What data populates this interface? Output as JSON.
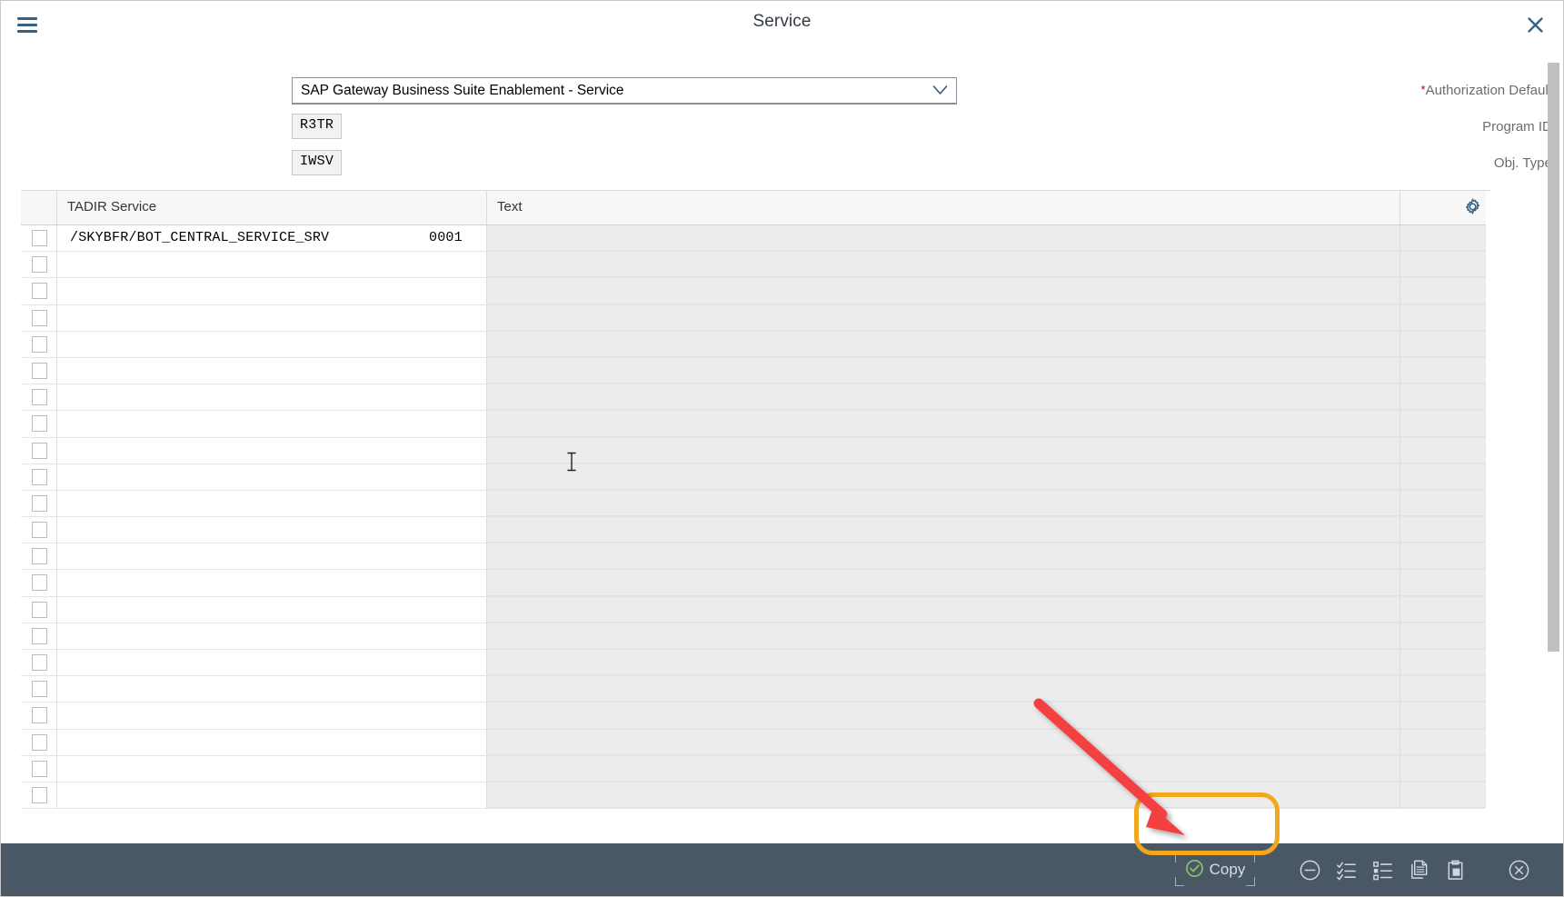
{
  "window": {
    "title": "Service",
    "menu_icon": "hamburger-menu-icon",
    "close_icon": "close-icon"
  },
  "form": {
    "authorization_default": {
      "label": "Authorization Default:",
      "required": true,
      "value": "SAP Gateway Business Suite Enablement - Service",
      "dropdown_icon": "chevron-down-icon"
    },
    "program_id": {
      "label": "Program ID:",
      "value": "R3TR",
      "readonly": true
    },
    "obj_type": {
      "label": "Obj. Type:",
      "value": "IWSV",
      "readonly": true
    }
  },
  "table": {
    "columns": [
      {
        "key": "select",
        "label": ""
      },
      {
        "key": "service",
        "label": "TADIR Service"
      },
      {
        "key": "text",
        "label": "Text"
      },
      {
        "key": "extra",
        "label": ""
      }
    ],
    "settings_icon": "gear-icon",
    "rows": [
      {
        "selected": false,
        "service": "/SKYBFR/BOT_CENTRAL_SERVICE_SRV",
        "version": "0001",
        "text": ""
      },
      {
        "selected": false,
        "service": "",
        "version": "",
        "text": ""
      },
      {
        "selected": false,
        "service": "",
        "version": "",
        "text": ""
      },
      {
        "selected": false,
        "service": "",
        "version": "",
        "text": ""
      },
      {
        "selected": false,
        "service": "",
        "version": "",
        "text": ""
      },
      {
        "selected": false,
        "service": "",
        "version": "",
        "text": ""
      },
      {
        "selected": false,
        "service": "",
        "version": "",
        "text": ""
      },
      {
        "selected": false,
        "service": "",
        "version": "",
        "text": ""
      },
      {
        "selected": false,
        "service": "",
        "version": "",
        "text": ""
      },
      {
        "selected": false,
        "service": "",
        "version": "",
        "text": ""
      },
      {
        "selected": false,
        "service": "",
        "version": "",
        "text": ""
      },
      {
        "selected": false,
        "service": "",
        "version": "",
        "text": ""
      },
      {
        "selected": false,
        "service": "",
        "version": "",
        "text": ""
      },
      {
        "selected": false,
        "service": "",
        "version": "",
        "text": ""
      },
      {
        "selected": false,
        "service": "",
        "version": "",
        "text": ""
      },
      {
        "selected": false,
        "service": "",
        "version": "",
        "text": ""
      },
      {
        "selected": false,
        "service": "",
        "version": "",
        "text": ""
      },
      {
        "selected": false,
        "service": "",
        "version": "",
        "text": ""
      },
      {
        "selected": false,
        "service": "",
        "version": "",
        "text": ""
      },
      {
        "selected": false,
        "service": "",
        "version": "",
        "text": ""
      },
      {
        "selected": false,
        "service": "",
        "version": "",
        "text": ""
      },
      {
        "selected": false,
        "service": "",
        "version": "",
        "text": ""
      }
    ]
  },
  "footer": {
    "copy_button": {
      "label": "Copy",
      "icon": "check-circle-icon",
      "focused": true
    },
    "actions": [
      {
        "name": "remove-button",
        "icon": "minus-circle-icon"
      },
      {
        "name": "select-all-button",
        "icon": "checklist-icon"
      },
      {
        "name": "list-options-button",
        "icon": "bullet-list-icon"
      },
      {
        "name": "copy-doc-button",
        "icon": "copy-documents-icon"
      },
      {
        "name": "paste-button",
        "icon": "paste-clipboard-icon"
      },
      {
        "name": "cancel-button",
        "icon": "close-circle-icon"
      }
    ]
  },
  "colors": {
    "accent": "#346187",
    "footer_bg": "#4a5866",
    "highlight_ring": "#f2a81e",
    "arrow": "#f43f3f",
    "required_star": "#bb0000",
    "readonly_bg": "#f2f2f2",
    "text_column_bg": "#ececec"
  }
}
